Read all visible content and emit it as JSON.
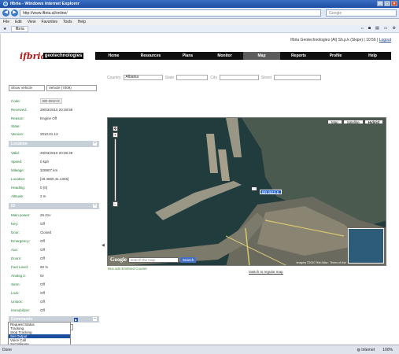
{
  "browser": {
    "title": "Ifbria - Windows Internet Explorer",
    "url": "http://www.ifbria.al/online/",
    "search_placeholder": "Google",
    "menu": [
      "File",
      "Edit",
      "View",
      "Favorites",
      "Tools",
      "Help"
    ],
    "tab_label": "Ifbria",
    "status_left": "Done",
    "status_zone": "Internet",
    "status_zoom": "100%"
  },
  "header": {
    "user_info": "Ifbria Geotechnologies (Al) Sh.p.k (Skipe) | 10:56 |",
    "logout": "Logout",
    "logo_mark": "ifbria",
    "logo_word": "geotechnologies",
    "nav": [
      "Home",
      "Resources",
      "Plans",
      "Monitor",
      "Map",
      "Reports",
      "Profile",
      "Help"
    ],
    "active_nav": "Map"
  },
  "filters": {
    "country_label": "Country",
    "country_value": "Albania",
    "state_label": "State",
    "city_label": "City",
    "street_label": "Street"
  },
  "vehicle": {
    "selector": "Show Vehicle",
    "vehicle_value": "Vehicle (7009)",
    "code_label": "Code:",
    "code_value": "BR-0810 E",
    "received_label": "Received:",
    "received_value": "29/03/2010 20:38:59",
    "reason_label": "Reason:",
    "reason_value": "Engine Off",
    "state_label": "State:",
    "version_label": "Version:",
    "version_value": "2010.01.13"
  },
  "location": {
    "title": "Location",
    "valid_label": "Valid:",
    "valid_value": "29/03/2010 20:38:49",
    "speed_label": "Speed:",
    "speed_value": "0 kph",
    "mileage_label": "Mileage:",
    "mileage_value": "328907 km",
    "location_label": "Location:",
    "location_value": "[19.4660,41.1345]",
    "heading_label": "Heading:",
    "heading_value": "0 (0)",
    "altitude_label": "Altitude:",
    "altitude_value": "2 m"
  },
  "io": {
    "title": "IO",
    "items": [
      {
        "label": "Main power:",
        "value": "26.31v"
      },
      {
        "label": "Key:",
        "value": "Off"
      },
      {
        "label": "Door:",
        "value": "Closed"
      },
      {
        "label": "Emergency:",
        "value": "Off"
      },
      {
        "label": "Aux:",
        "value": "Off"
      },
      {
        "label": "Doors:",
        "value": "Off"
      },
      {
        "label": "Fuel Level:",
        "value": "60 %"
      },
      {
        "label": "Analog 2:",
        "value": "0v"
      },
      {
        "label": "Siren:",
        "value": "Off"
      },
      {
        "label": "Lock:",
        "value": "Off"
      },
      {
        "label": "Unlock:",
        "value": "Off"
      },
      {
        "label": "Immobilizer:",
        "value": "Off"
      }
    ]
  },
  "commands": {
    "title": "Commands",
    "selected": "Set Output",
    "options": [
      "Request Status",
      "Tracking",
      "Stop Tracking",
      "Set Output",
      "Voice Call",
      "Set Mileage",
      "Reset State"
    ],
    "highlighted": "Set Output"
  },
  "map": {
    "types": [
      "Map",
      "Satellite",
      "Hybrid"
    ],
    "active_type": "Hybrid",
    "marker_label": "BR 0810 E",
    "google_logo": "Google",
    "search_placeholder": "search the map",
    "search_button": "Search",
    "copyright": "Imagery ©2010 Tele Atlas · Terms of Use",
    "below_text": "Bus ads Erisfeed Courier",
    "switch_link": "Switch to regular map"
  }
}
